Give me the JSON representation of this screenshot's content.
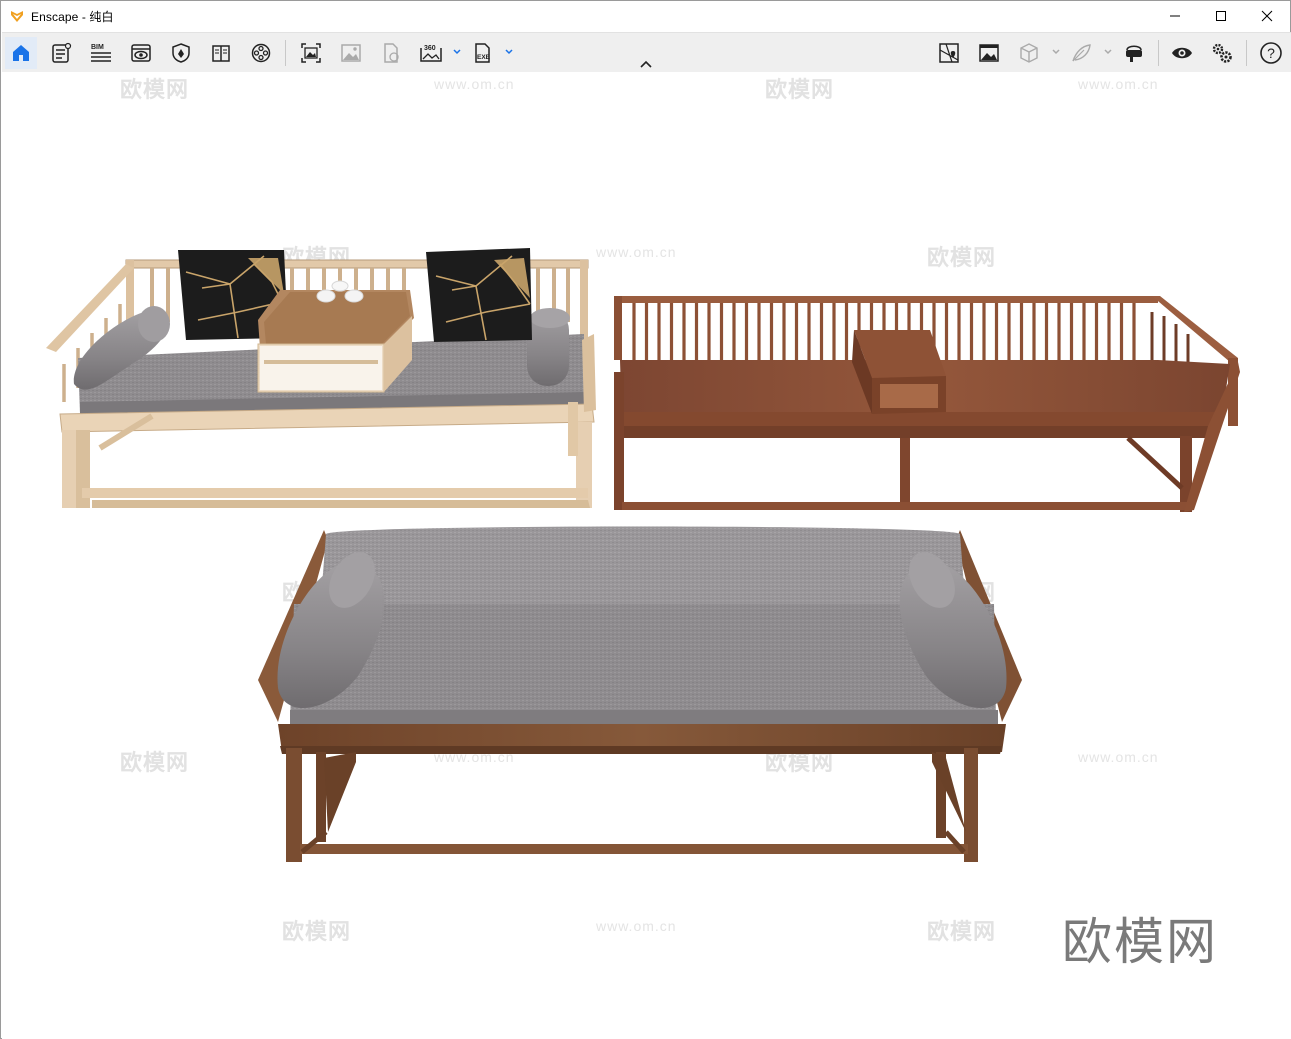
{
  "window": {
    "title": "Enscape - 纯白",
    "brand_color": "#f0a020",
    "controls": [
      {
        "name": "minimize-button",
        "icon": "minimize-icon"
      },
      {
        "name": "maximize-button",
        "icon": "maximize-icon"
      },
      {
        "name": "close-button",
        "icon": "close-icon"
      }
    ]
  },
  "toolbar": {
    "accent": "#1a73e8",
    "left_tools": [
      {
        "name": "home-button",
        "icon": "home-icon",
        "active": true
      },
      {
        "name": "settings-sheet-button",
        "icon": "document-settings-icon"
      },
      {
        "name": "bim-button",
        "icon": "bim-icon",
        "label": "BIM"
      },
      {
        "name": "visual-settings-button",
        "icon": "eye-window-icon"
      },
      {
        "name": "asset-library-button",
        "icon": "asset-shield-icon"
      },
      {
        "name": "material-editor-button",
        "icon": "book-icon"
      },
      {
        "name": "video-editor-button",
        "icon": "film-reel-icon"
      }
    ],
    "capture_tools": [
      {
        "name": "screenshot-button",
        "icon": "capture-icon"
      },
      {
        "name": "batch-render-button",
        "icon": "image-icon"
      },
      {
        "name": "export-file-button",
        "icon": "file-export-icon"
      },
      {
        "name": "panorama-button",
        "icon": "panorama-360-icon",
        "label": "360"
      },
      {
        "name": "exe-export-button",
        "icon": "exe-icon",
        "label": "EXE"
      }
    ],
    "right_tools": [
      {
        "name": "site-context-button",
        "icon": "map-pin-icon"
      },
      {
        "name": "rendered-views-button",
        "icon": "gallery-icon"
      },
      {
        "name": "cube-button",
        "icon": "cube-icon"
      },
      {
        "name": "feather-button",
        "icon": "feather-icon"
      },
      {
        "name": "vr-headset-button",
        "icon": "vr-headset-icon"
      },
      {
        "name": "preview-button",
        "icon": "eye-icon"
      },
      {
        "name": "general-settings-button",
        "icon": "gears-icon"
      },
      {
        "name": "help-button",
        "icon": "help-icon",
        "label": "?"
      }
    ]
  },
  "viewport": {
    "watermarks": [
      "欧模网",
      "www.om.cn"
    ],
    "brand_watermark": "欧模网",
    "colors": {
      "light_wood": "#e6cfb2",
      "dark_wood": "#8e5236",
      "medium_wood": "#7d4e33",
      "cushion_gray": "#8f8c8f",
      "pillow_black": "#1c1c1c",
      "pillow_gold": "#c9a46a"
    }
  }
}
